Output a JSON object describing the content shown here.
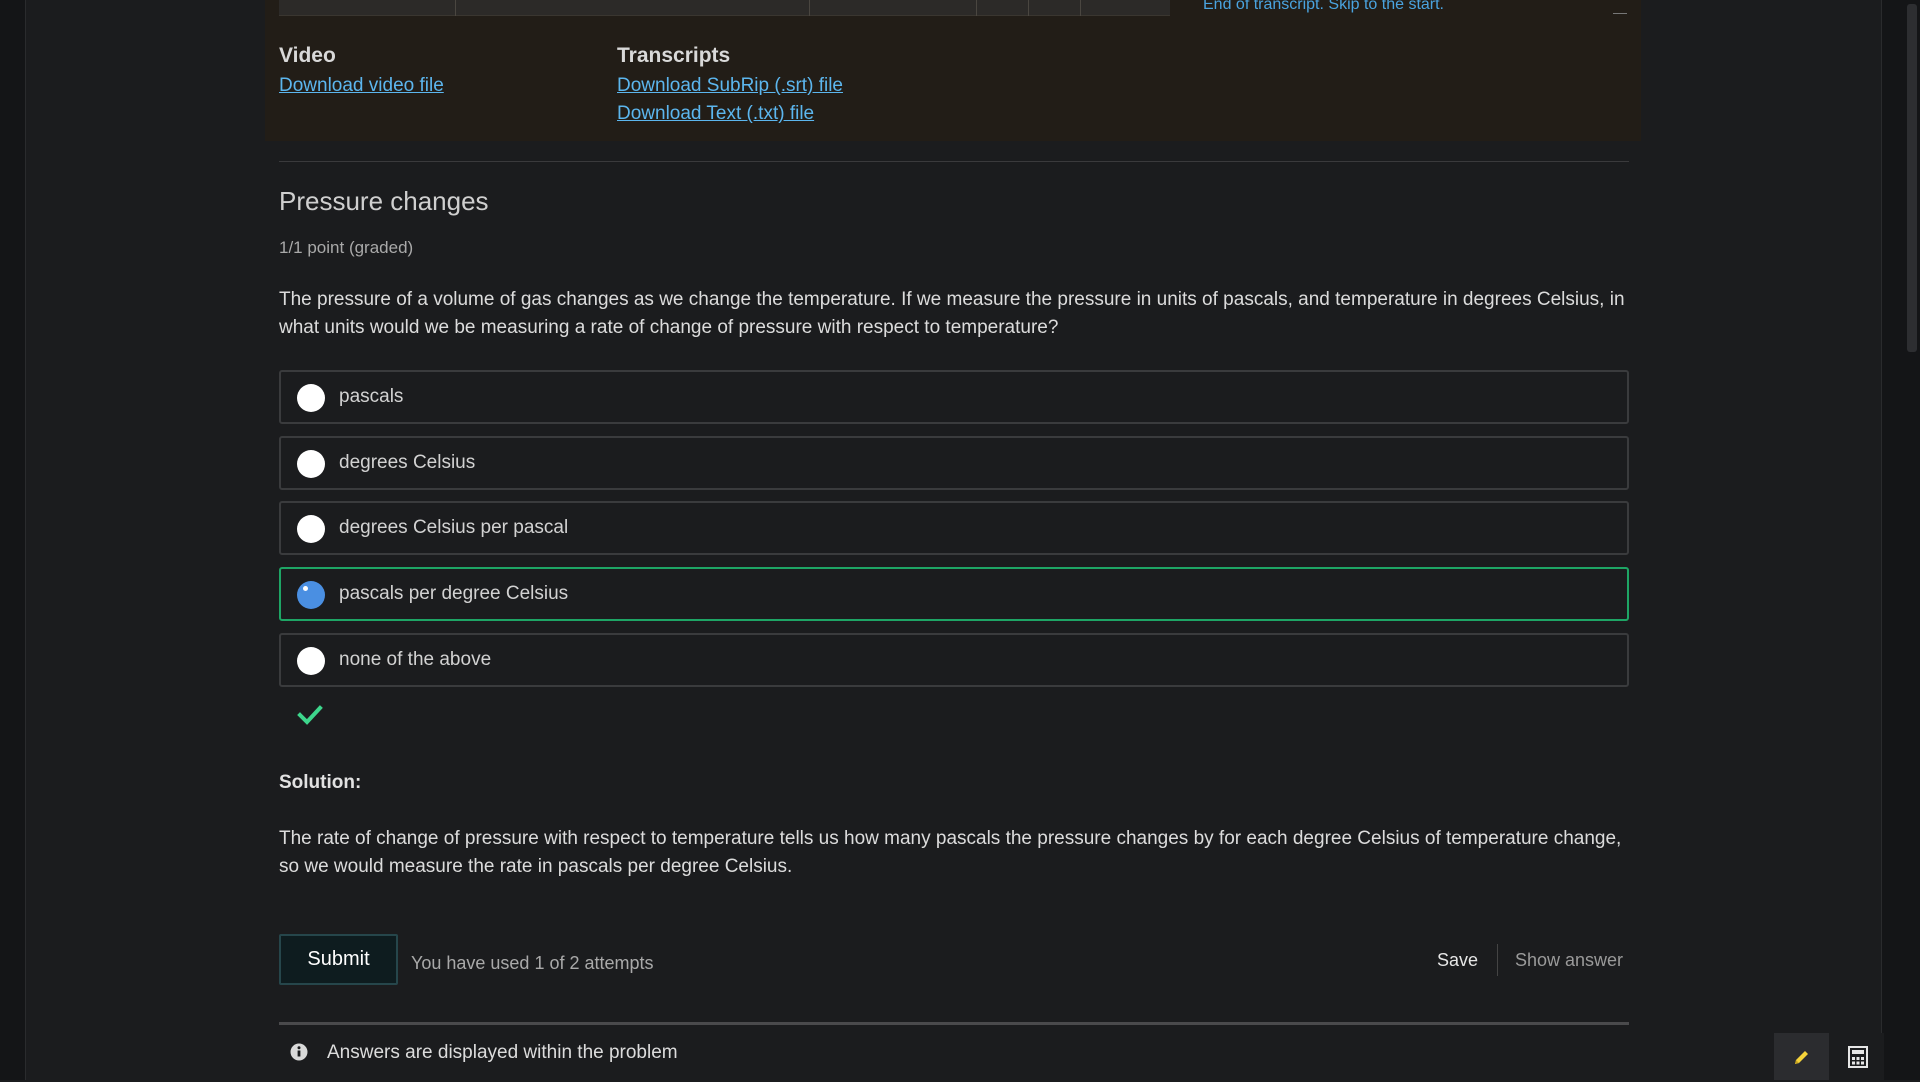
{
  "video_section": {
    "transcript_end_text": "End of transcript. Skip to the start.",
    "video_heading": "Video",
    "video_link": "Download video file",
    "transcripts_heading": "Transcripts",
    "srt_link": "Download SubRip (.srt) file",
    "txt_link": "Download Text (.txt) file"
  },
  "problem": {
    "title": "Pressure changes",
    "points": "1/1 point (graded)",
    "question": "The pressure of a volume of gas changes as we change the temperature. If we measure the pressure in units of pascals, and temperature in degrees Celsius, in what units would we be measuring a rate of change of pressure with respect to temperature?",
    "options": [
      {
        "label": "pascals",
        "selected": false
      },
      {
        "label": "degrees Celsius",
        "selected": false
      },
      {
        "label": "degrees Celsius per pascal",
        "selected": false
      },
      {
        "label": "pascals per degree Celsius",
        "selected": true,
        "status": "correct"
      },
      {
        "label": "none of the above",
        "selected": false
      }
    ],
    "result_icon": "check-icon",
    "solution_heading": "Solution:",
    "solution_text": "The rate of change of pressure with respect to temperature tells us how many pascals the pressure changes by for each degree Celsius of temperature change, so we would measure the rate in pascals per degree Celsius."
  },
  "actions": {
    "submit_label": "Submit",
    "attempts_text": "You have used 1 of 2 attempts",
    "save_label": "Save",
    "show_answer_label": "Show answer"
  },
  "notice": {
    "icon": "info-icon",
    "text": "Answers are displayed within the problem"
  },
  "tools": {
    "pencil_icon": "pencil-icon",
    "calculator_icon": "calculator-icon"
  },
  "colors": {
    "background": "#1b1c1e",
    "link": "#5cb6ee",
    "correct_border": "#1ea565",
    "checkmark": "#3dd68c",
    "radio_selected": "#4a8fe2",
    "pencil": "#f5d33a"
  }
}
